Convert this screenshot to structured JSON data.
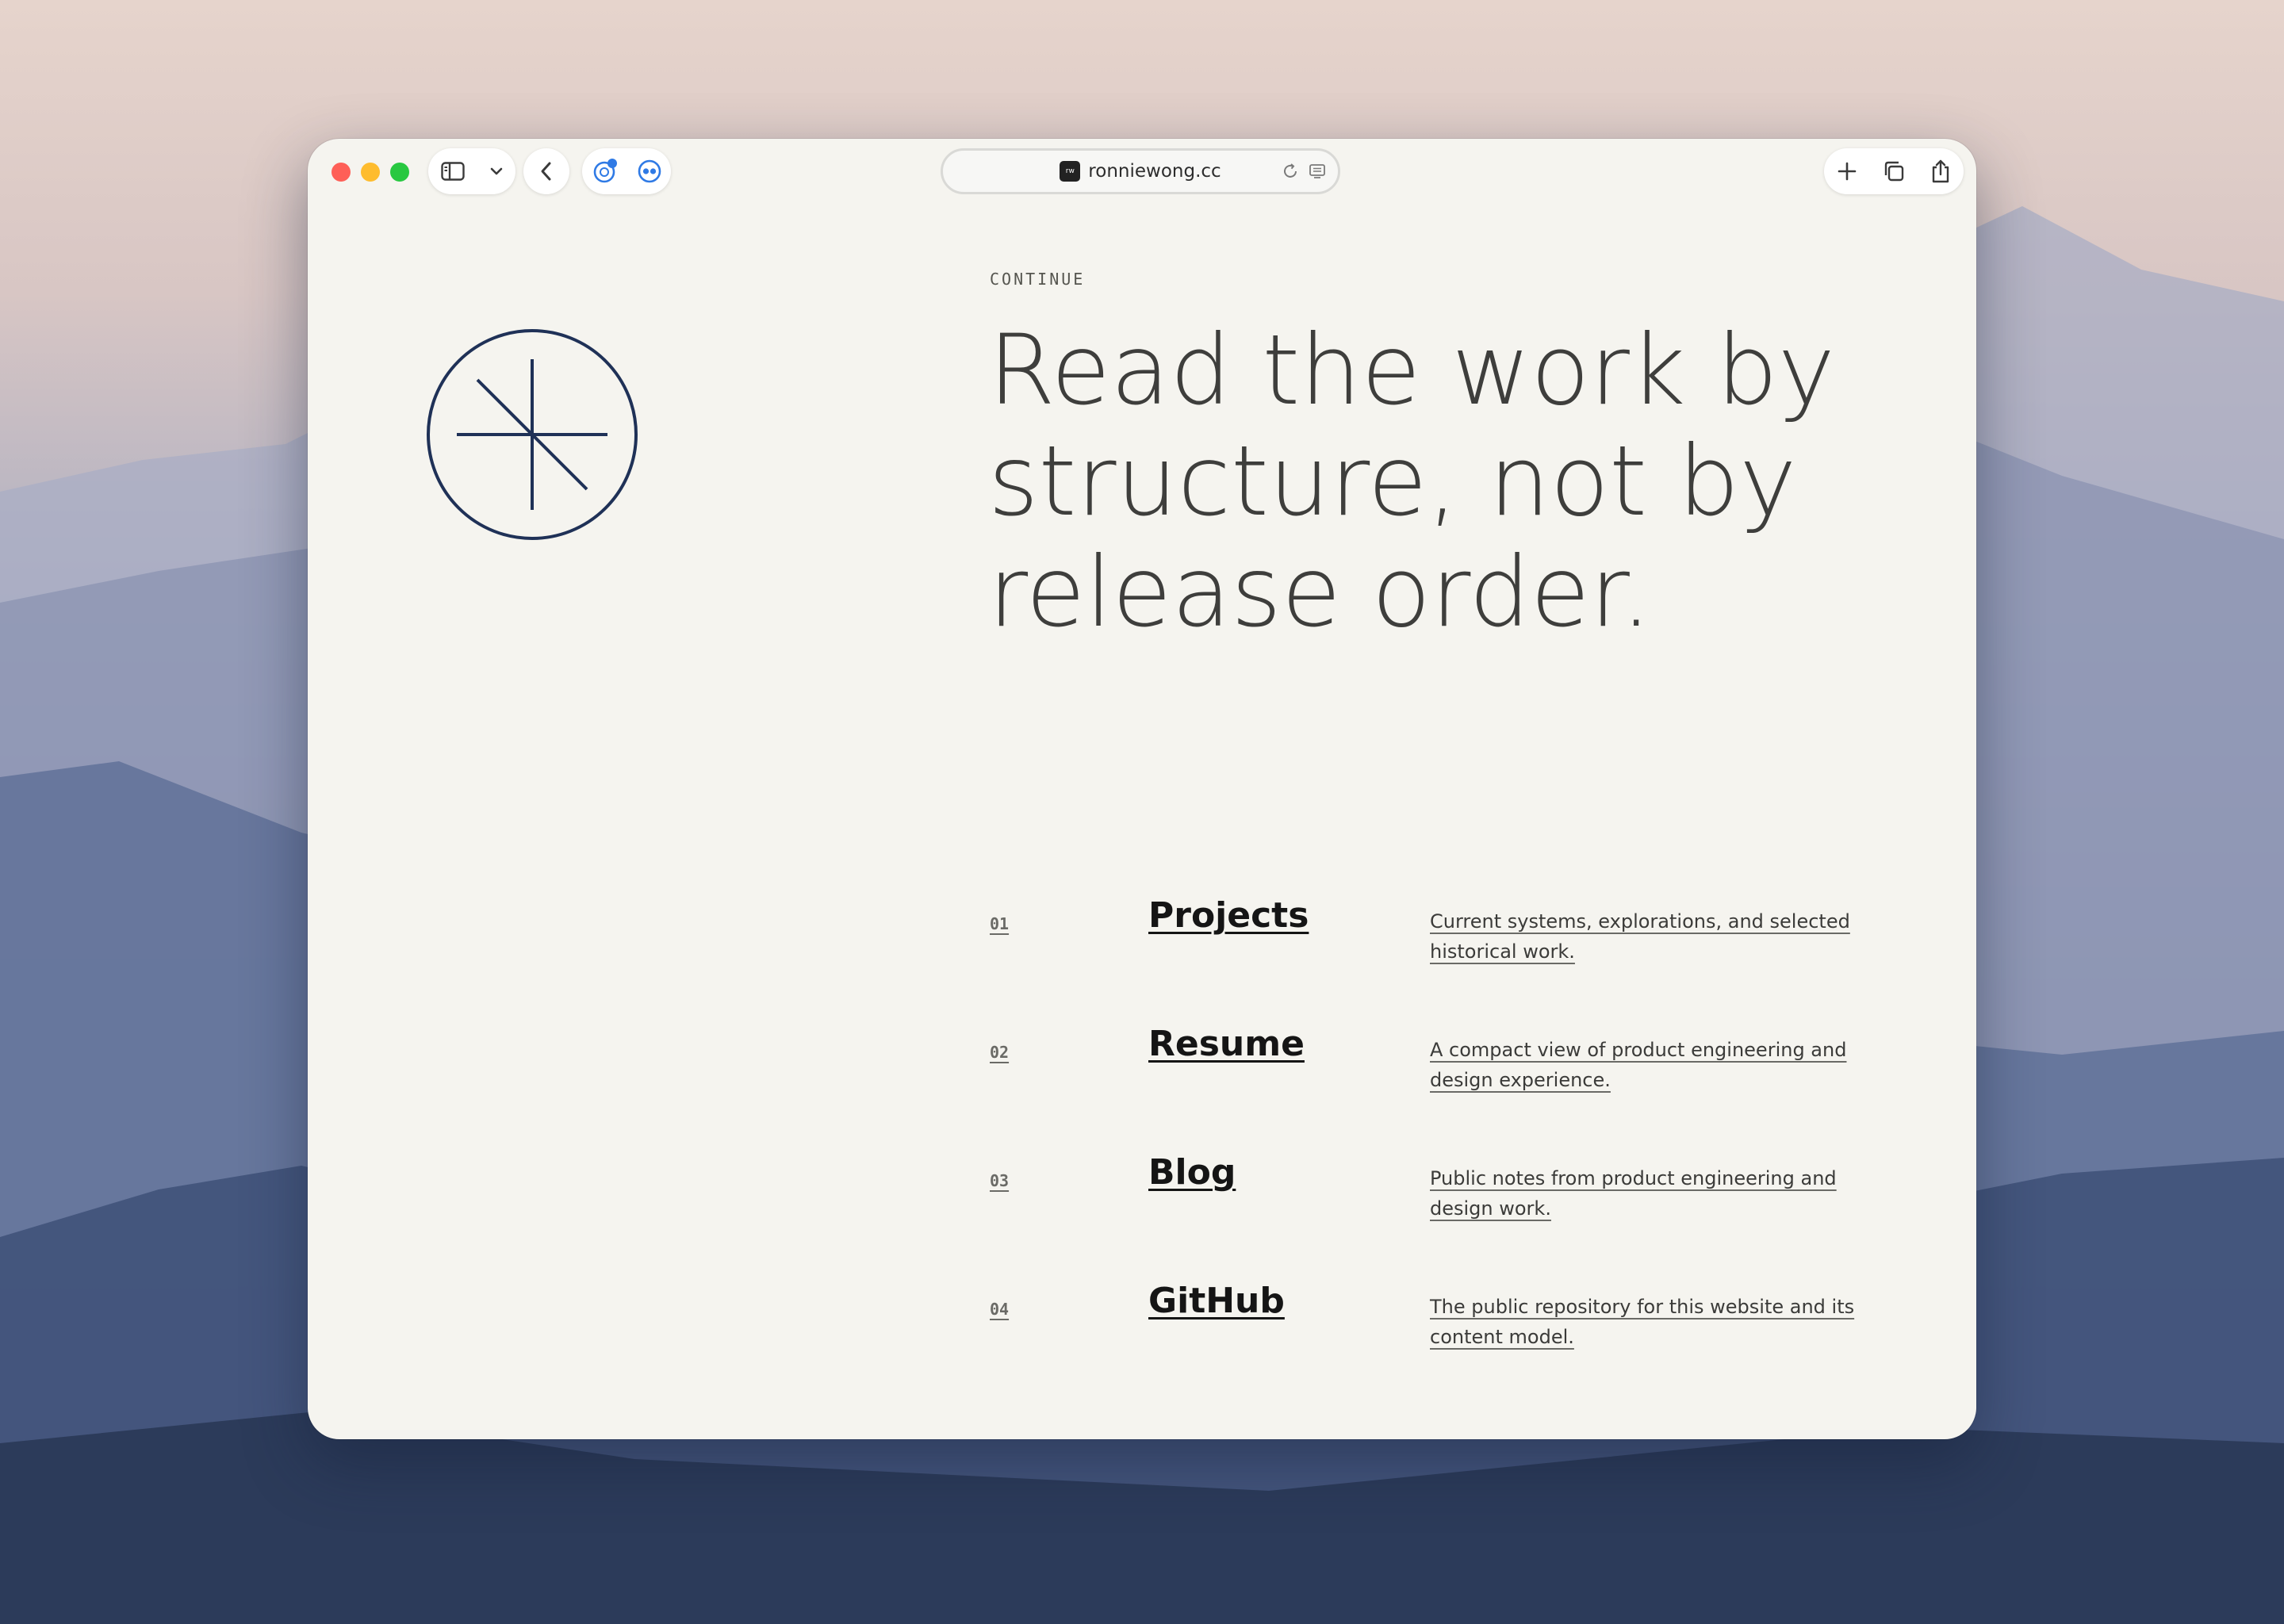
{
  "browser": {
    "url": "ronniewong.cc",
    "favicon_text": "rw",
    "icons": {
      "sidebar": "sidebar-icon",
      "chevron": "chevron-down-icon",
      "back": "back-arrow-icon",
      "ext1": "extension-icon",
      "ext2": "extension-eyes-icon",
      "reload": "reload-icon",
      "reader": "reader-icon",
      "new_tab": "plus-icon",
      "tabs": "tabs-overview-icon",
      "share": "share-icon"
    }
  },
  "page": {
    "eyebrow": "CONTINUE",
    "headline_lines": [
      "Read the work by",
      "structure, not by",
      "release order."
    ],
    "links": [
      {
        "num": "01",
        "title": "Projects",
        "desc": "Current systems, explorations, and selected historical work."
      },
      {
        "num": "02",
        "title": "Resume",
        "desc": "A compact view of product engineering and design experience."
      },
      {
        "num": "03",
        "title": "Blog",
        "desc": "Public notes from product engineering and design work."
      },
      {
        "num": "04",
        "title": "GitHub",
        "desc": "The public repository for this website and its content model."
      }
    ]
  },
  "colors": {
    "logo_stroke": "#1f3157",
    "page_bg": "#f5f4ef",
    "text_dark": "#151515"
  }
}
